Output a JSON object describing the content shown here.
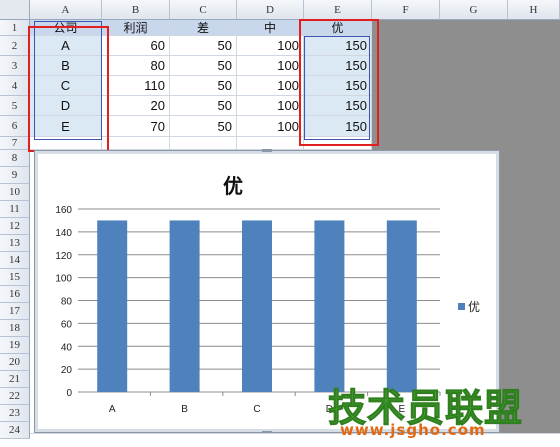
{
  "spreadsheet": {
    "columns": [
      "A",
      "B",
      "C",
      "D",
      "E",
      "F",
      "G",
      "H"
    ],
    "rows": [
      "1",
      "2",
      "3",
      "4",
      "5",
      "6",
      "7",
      "8",
      "9",
      "10",
      "11",
      "12",
      "13",
      "14",
      "15",
      "16",
      "17",
      "18",
      "19",
      "20",
      "21",
      "22",
      "23",
      "24"
    ],
    "headers": [
      "公司",
      "利润",
      "差",
      "中",
      "优"
    ],
    "data": [
      [
        "A",
        "60",
        "50",
        "100",
        "150"
      ],
      [
        "B",
        "80",
        "50",
        "100",
        "150"
      ],
      [
        "C",
        "110",
        "50",
        "100",
        "150"
      ],
      [
        "D",
        "20",
        "50",
        "100",
        "150"
      ],
      [
        "E",
        "70",
        "50",
        "100",
        "150"
      ]
    ]
  },
  "chart_data": {
    "type": "bar",
    "title": "优",
    "categories": [
      "A",
      "B",
      "C",
      "D",
      "E"
    ],
    "series": [
      {
        "name": "优",
        "values": [
          150,
          150,
          150,
          150,
          150
        ],
        "color": "#4f81bd"
      }
    ],
    "ylim": [
      0,
      160
    ],
    "yticks": [
      "0",
      "20",
      "40",
      "60",
      "80",
      "100",
      "120",
      "140",
      "160"
    ],
    "legend": "right",
    "grid": true
  },
  "watermark": {
    "line1": "技术员联盟",
    "line2": "www.jsgho.com"
  }
}
